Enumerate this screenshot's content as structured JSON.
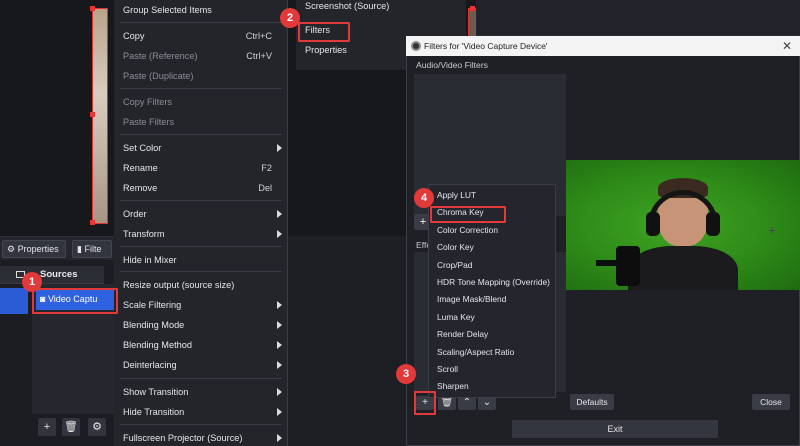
{
  "context_menu": {
    "items": [
      {
        "label": "Group Selected Items",
        "shortcut": "",
        "disabled": false,
        "submenu": false
      },
      {
        "label": "Copy",
        "shortcut": "Ctrl+C",
        "disabled": false,
        "submenu": false
      },
      {
        "label": "Paste (Reference)",
        "shortcut": "Ctrl+V",
        "disabled": true,
        "submenu": false
      },
      {
        "label": "Paste (Duplicate)",
        "shortcut": "",
        "disabled": true,
        "submenu": false
      },
      {
        "label": "Copy Filters",
        "shortcut": "",
        "disabled": true,
        "submenu": false
      },
      {
        "label": "Paste Filters",
        "shortcut": "",
        "disabled": true,
        "submenu": false
      },
      {
        "label": "Set Color",
        "shortcut": "",
        "disabled": false,
        "submenu": true
      },
      {
        "label": "Rename",
        "shortcut": "F2",
        "disabled": false,
        "submenu": false
      },
      {
        "label": "Remove",
        "shortcut": "Del",
        "disabled": false,
        "submenu": false
      },
      {
        "label": "Order",
        "shortcut": "",
        "disabled": false,
        "submenu": true
      },
      {
        "label": "Transform",
        "shortcut": "",
        "disabled": false,
        "submenu": true
      },
      {
        "label": "Hide in Mixer",
        "shortcut": "",
        "disabled": false,
        "submenu": false
      },
      {
        "label": "Resize output (source size)",
        "shortcut": "",
        "disabled": false,
        "submenu": false
      },
      {
        "label": "Scale Filtering",
        "shortcut": "",
        "disabled": false,
        "submenu": true
      },
      {
        "label": "Blending Mode",
        "shortcut": "",
        "disabled": false,
        "submenu": true
      },
      {
        "label": "Blending Method",
        "shortcut": "",
        "disabled": false,
        "submenu": true
      },
      {
        "label": "Deinterlacing",
        "shortcut": "",
        "disabled": false,
        "submenu": true
      },
      {
        "label": "Show Transition",
        "shortcut": "",
        "disabled": false,
        "submenu": true
      },
      {
        "label": "Hide Transition",
        "shortcut": "",
        "disabled": false,
        "submenu": true
      },
      {
        "label": "Fullscreen Projector (Source)",
        "shortcut": "",
        "disabled": false,
        "submenu": true
      }
    ]
  },
  "sub_menu": {
    "screenshot": "Screenshot (Source)",
    "filters": "Filters",
    "properties": "Properties"
  },
  "main": {
    "properties_button": "Properties",
    "filters_button": "Filte",
    "sources_title": "Sources",
    "source_item": "Video Captu",
    "sources_add_icon": "plus-icon",
    "sources_remove_icon": "trash-icon",
    "sources_settings_icon": "gear-icon"
  },
  "dialog": {
    "title": "Filters for 'Video Capture Device'",
    "close_glyph": "✕",
    "audio_video_label": "Audio/Video Filters",
    "effect_label": "Effe",
    "add_left_glyph": "+",
    "defaults_button": "Defaults",
    "close_button": "Close",
    "exit_button": "Exit",
    "tool_icons": [
      "plus-icon",
      "trash-icon",
      "arrow-up-icon",
      "arrow-down-icon"
    ],
    "tool_glyphs": [
      "+",
      "🗑",
      "⌃",
      "⌄"
    ]
  },
  "filter_popup": {
    "items": [
      "Apply LUT",
      "Chroma Key",
      "Color Correction",
      "Color Key",
      "Crop/Pad",
      "HDR Tone Mapping (Override)",
      "Image Mask/Blend",
      "Luma Key",
      "Render Delay",
      "Scaling/Aspect Ratio",
      "Scroll",
      "Sharpen"
    ]
  },
  "annotations": {
    "badge_1": "1",
    "badge_2": "2",
    "badge_3": "3",
    "badge_4": "4",
    "color": "#e23a3a"
  },
  "colors": {
    "selection_blue": "#2f62e0",
    "chroma_green": "#3fa323",
    "menu_bg": "#24252b"
  }
}
